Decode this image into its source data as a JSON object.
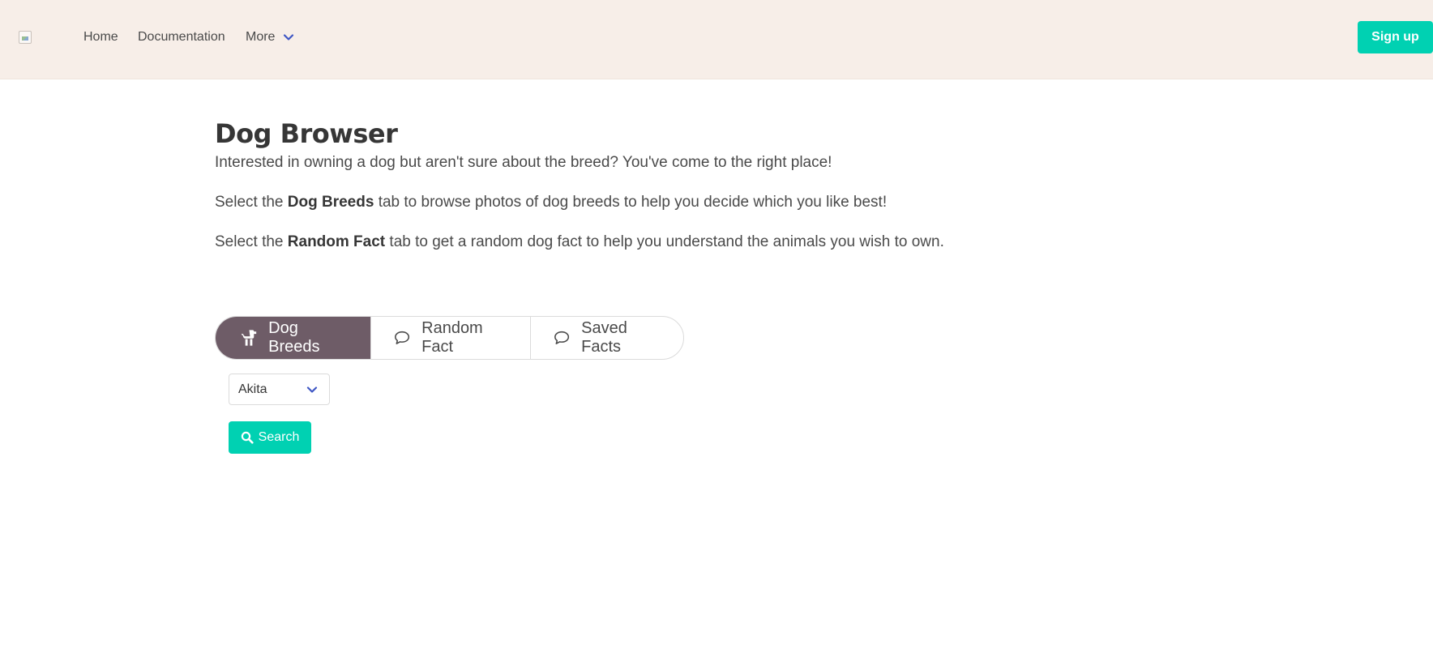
{
  "navbar": {
    "logo_icon": "broken-image-icon",
    "links": {
      "home": "Home",
      "documentation": "Documentation",
      "more": "More"
    },
    "more_icon": "chevron-down-icon",
    "signup_label": "Sign up"
  },
  "main": {
    "title": "Dog Browser",
    "intro_line": "Interested in owning a dog but aren't sure about the breed? You've come to the right place!",
    "breeds_line": {
      "prefix": "Select the ",
      "bold": "Dog Breeds",
      "suffix": " tab to browse photos of dog breeds to help you decide which you like best!"
    },
    "fact_line": {
      "prefix": "Select the ",
      "bold": "Random Fact",
      "suffix": " tab to get a random dog fact to help you understand the animals you wish to own."
    }
  },
  "tabs": [
    {
      "label": "Dog Breeds",
      "icon": "dog-icon",
      "active": true
    },
    {
      "label": "Random Fact",
      "icon": "speech-bubble-icon",
      "active": false
    },
    {
      "label": "Saved Facts",
      "icon": "speech-bubble-icon",
      "active": false
    }
  ],
  "breed_select": {
    "value": "Akita",
    "icon": "chevron-down-icon"
  },
  "search_button": {
    "label": "Search",
    "icon": "search-icon"
  },
  "colors": {
    "navbar_bg": "#f7eee8",
    "primary": "#00d1b2",
    "active_tab": "#6e5c67",
    "chevron": "#3e56c4"
  }
}
